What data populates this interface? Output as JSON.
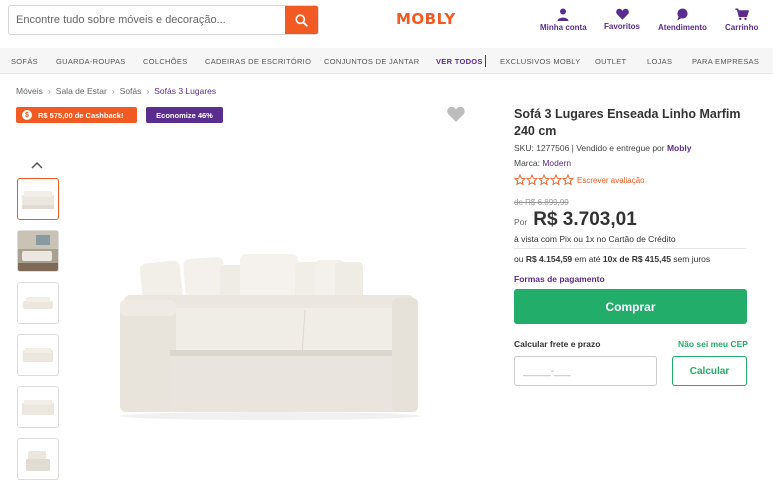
{
  "header": {
    "search_placeholder": "Encontre tudo sobre móveis e decoração...",
    "logo": "MOBLY",
    "items": [
      {
        "label": "Minha conta",
        "icon": "user-icon"
      },
      {
        "label": "Favoritos",
        "icon": "heart-icon"
      },
      {
        "label": "Atendimento",
        "icon": "chat-icon"
      },
      {
        "label": "Carrinho",
        "icon": "cart-icon"
      }
    ]
  },
  "nav": {
    "items": [
      "SOFÁS",
      "GUARDA-ROUPAS",
      "COLCHÕES",
      "CADEIRAS DE ESCRITÓRIO",
      "CONJUNTOS DE JANTAR",
      "VER TODOS",
      "EXCLUSIVOS MOBLY",
      "OUTLET",
      "LOJAS",
      "PARA EMPRESAS"
    ]
  },
  "breadcrumb": [
    "Móveis",
    "Sala de Estar",
    "Sofás",
    "Sofás 3 Lugares"
  ],
  "badges": {
    "cashback": "R$ 575,00 de Cashback!",
    "discount": "Economize 46%"
  },
  "product": {
    "title": "Sofá 3 Lugares Enseada Linho Marfim 240 cm",
    "sku_label": "SKU: 1277506 | Vendido e entregue por ",
    "seller": "Mobly",
    "brand_label": "Marca: ",
    "brand": "Modern",
    "review_link": "Escrever avaliação",
    "old_price": "de R$ 6.899,99",
    "price_prefix": "Por",
    "price": "R$ 3.703,01",
    "vista_text": "à vista com Pix ou 1x no Cartão de Crédito",
    "install_prefix": "ou ",
    "install_total": "R$ 4.154,59",
    "install_mid": " em até ",
    "install_parcels": "10x de R$ 415,45",
    "install_suffix": " sem juros",
    "payment_link": "Formas de pagamento",
    "buy_label": "Comprar",
    "shipping_label": "Calcular frete e prazo",
    "cep_link": "Não sei meu CEP",
    "cep_placeholder": "_____-___",
    "calc_label": "Calcular"
  },
  "colors": {
    "accent_orange": "#f15a22",
    "purple": "#5b2d8e",
    "green": "#22ad6b"
  }
}
